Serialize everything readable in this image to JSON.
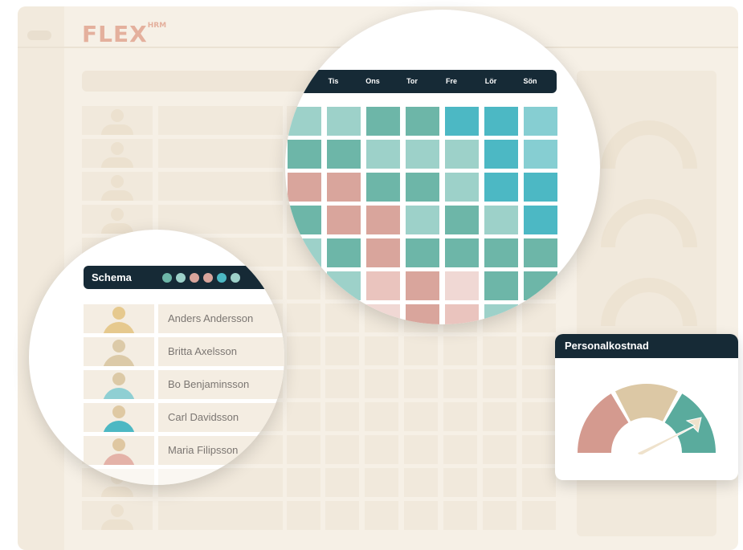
{
  "app": {
    "logo_text": "FLEX",
    "logo_suffix": "HRM",
    "logo_color": "#e4b09d"
  },
  "schedule": {
    "days": [
      "Tis",
      "Ons",
      "Tor",
      "Fre",
      "Lör",
      "Sön"
    ],
    "header_color": "#162a36",
    "palette": {
      "a": "#9dd1c9",
      "b": "#6db6a8",
      "c": "#4cb8c4",
      "d": "#86ced2",
      "e": "#d9a59c",
      "f": "#eac4be",
      "g": "#f0d8d4",
      "h": "#b9e2e6"
    },
    "grid": [
      [
        "a",
        "a",
        "b",
        "b",
        "c",
        "c",
        "d"
      ],
      [
        "b",
        "b",
        "a",
        "a",
        "a",
        "c",
        "d"
      ],
      [
        "e",
        "e",
        "b",
        "b",
        "a",
        "c",
        "c"
      ],
      [
        "b",
        "e",
        "e",
        "a",
        "b",
        "a",
        "c"
      ],
      [
        "a",
        "b",
        "e",
        "b",
        "b",
        "b",
        "b"
      ],
      [
        "b",
        "a",
        "f",
        "e",
        "g",
        "b",
        "b"
      ],
      [
        "h",
        "h",
        "g",
        "e",
        "f",
        "a",
        "a"
      ]
    ]
  },
  "schema": {
    "title": "Schema",
    "dot_colors": [
      "#6db6a8",
      "#9dd1c9",
      "#d9a59c",
      "#d9a59c",
      "#4cb8c4",
      "#9dd1c9"
    ],
    "people": [
      {
        "name": "Anders Andersson",
        "head": "#e6c98e",
        "body": "#e6c98e"
      },
      {
        "name": "Britta Axelsson",
        "head": "#dccaa8",
        "body": "#dccaa8"
      },
      {
        "name": "Bo Benjaminsson",
        "head": "#dcc9a6",
        "body": "#8fcfd3"
      },
      {
        "name": "Carl Davidsson",
        "head": "#dfc9a3",
        "body": "#4db8c3"
      },
      {
        "name": "Maria Filipsson",
        "head": "#dfc7a1",
        "body": "#e4b2a8"
      }
    ]
  },
  "cost_card": {
    "title": "Personalkostnad",
    "gauge_colors": [
      "#d49a8f",
      "#dcc8a5",
      "#5aab9d"
    ],
    "needle_color": "#efe2cc"
  }
}
